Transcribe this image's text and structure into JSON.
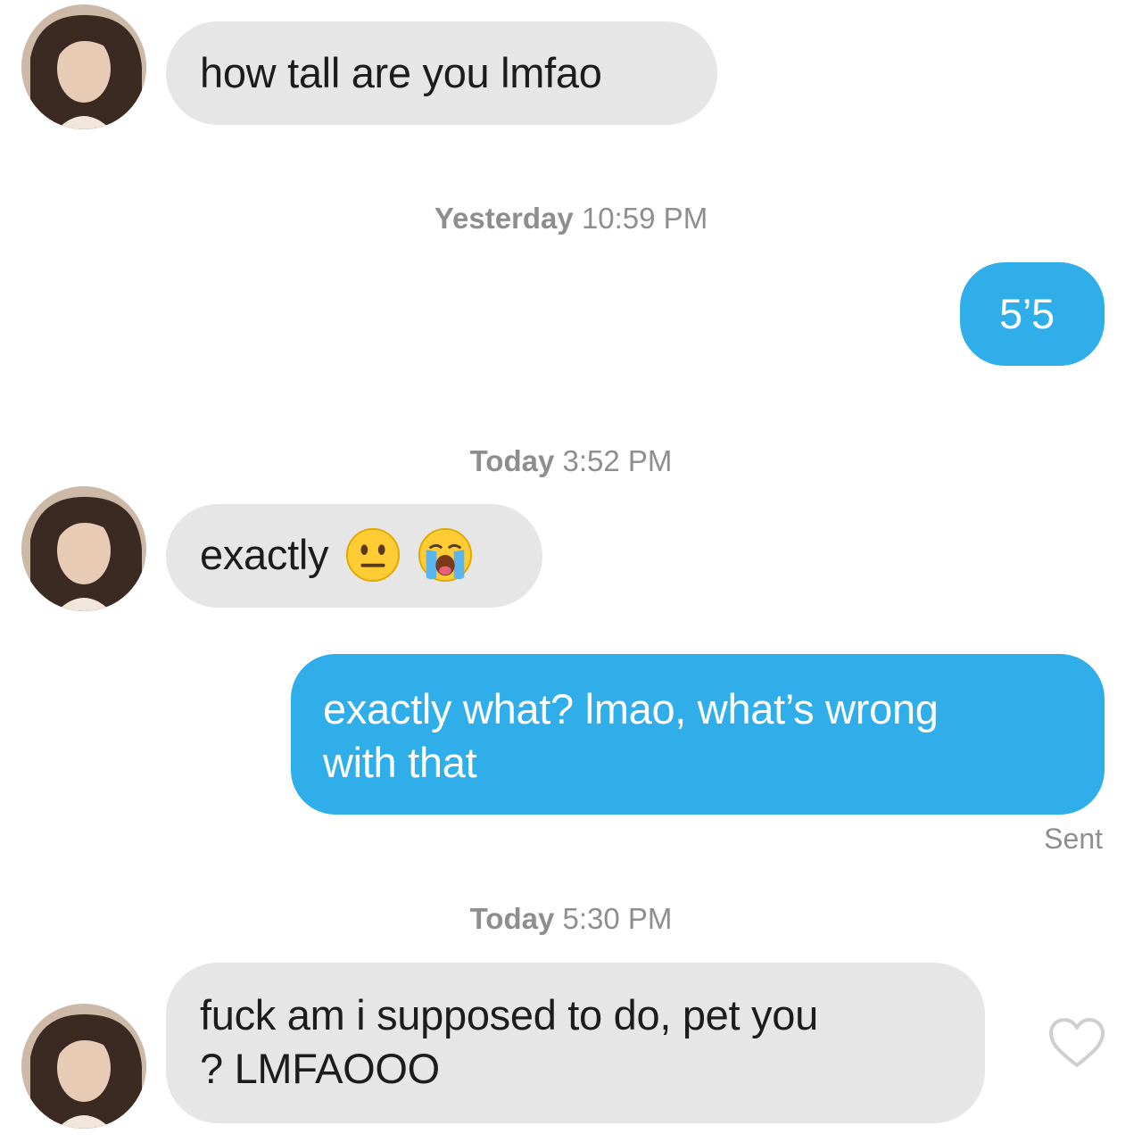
{
  "messages": [
    {
      "from": "them",
      "text": "how tall are you lmfao"
    },
    {
      "from": "me",
      "text": "5’5"
    },
    {
      "from": "them",
      "text": "exactly",
      "emojis": [
        "neutral-face-icon",
        "loudly-crying-face-icon"
      ]
    },
    {
      "from": "me",
      "line1": "exactly what? lmao, what’s wrong",
      "line2": "with that",
      "status": "Sent"
    },
    {
      "from": "them",
      "line1": "fuck am i supposed to do, pet you",
      "line2": "? LMFAOOO"
    }
  ],
  "timestamps": [
    {
      "day": "Yesterday",
      "time": "10:59 PM"
    },
    {
      "day": "Today",
      "time": "3:52 PM"
    },
    {
      "day": "Today",
      "time": "5:30 PM"
    }
  ],
  "colors": {
    "incoming_bubble": "#e6e6e6",
    "outgoing_bubble": "#2faeea",
    "timestamp_text": "#8e8e8e"
  }
}
